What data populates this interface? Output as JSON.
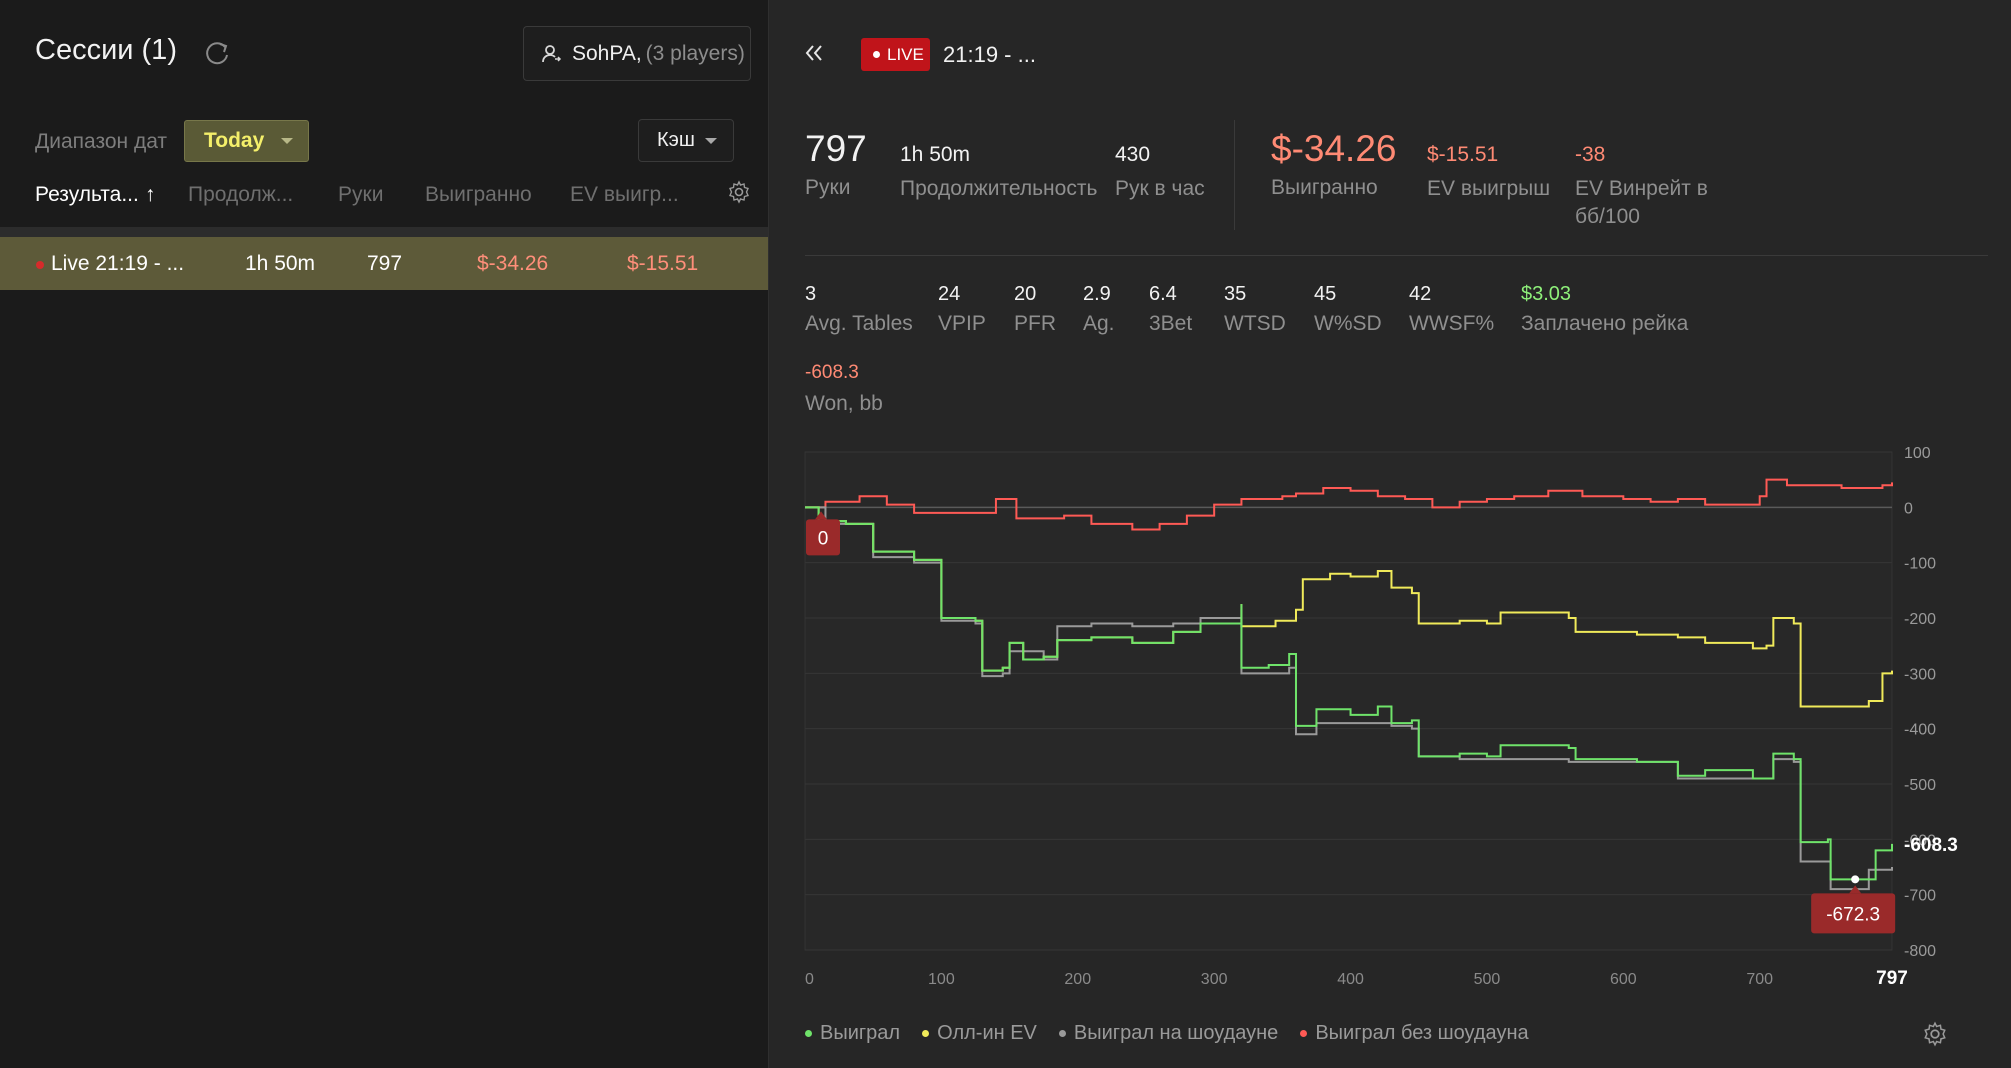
{
  "left": {
    "title": "Сессии (1)",
    "player": {
      "name": "SohPA,",
      "extra": "(3 players)"
    },
    "date_range_label": "Диапазон дат",
    "date_range_value": "Today",
    "game_type": "Кэш",
    "columns": [
      "Результа...",
      "Продолж...",
      "Руки",
      "Выигранно",
      "EV выигр..."
    ],
    "sort_arrow": "↑",
    "session": {
      "name": "Live 21:19 - ...",
      "duration": "1h 50m",
      "hands": "797",
      "won": "$-34.26",
      "ev": "$-15.51"
    }
  },
  "right": {
    "live": "LIVE",
    "title": "21:19 - ...",
    "stats": {
      "hands": {
        "value": "797",
        "label": "Руки"
      },
      "duration": {
        "value": "1h 50m",
        "label": "Продолжительность"
      },
      "hands_per_hour": {
        "value": "430",
        "label": "Рук в час"
      },
      "won": {
        "value": "$-34.26",
        "label": "Выигранно"
      },
      "ev_won": {
        "value": "$-15.51",
        "label": "EV выигрыш"
      },
      "ev_winrate": {
        "value": "-38",
        "label": "EV Винрейт в",
        "label2": "бб/100"
      }
    },
    "stats2": [
      {
        "value": "3",
        "label": "Avg. Tables"
      },
      {
        "value": "24",
        "label": "VPIP"
      },
      {
        "value": "20",
        "label": "PFR"
      },
      {
        "value": "2.9",
        "label": "Ag."
      },
      {
        "value": "6.4",
        "label": "3Bet"
      },
      {
        "value": "35",
        "label": "WTSD"
      },
      {
        "value": "45",
        "label": "W%SD"
      },
      {
        "value": "42",
        "label": "WWSF%"
      },
      {
        "value": "$3.03",
        "label": "Заплачено рейка"
      }
    ],
    "won_bb": {
      "value": "-608.3",
      "label": "Won, bb"
    },
    "legend": [
      {
        "label": "Выиграл",
        "color": "#6fe36a"
      },
      {
        "label": "Олл-ин EV",
        "color": "#f0ea5a"
      },
      {
        "label": "Выиграл на шоудауне",
        "color": "#9a9a9a"
      },
      {
        "label": "Выиграл без шоудауна",
        "color": "#ff5a55"
      }
    ]
  },
  "chart_data": {
    "type": "line",
    "x_range": [
      0,
      797
    ],
    "y_range": [
      -800,
      100
    ],
    "x_ticks": [
      0,
      100,
      200,
      300,
      400,
      500,
      600,
      700
    ],
    "x_end_label": "797",
    "y_ticks": [
      100,
      0,
      -100,
      -200,
      -300,
      -400,
      -500,
      -600,
      -700,
      -800
    ],
    "start_marker": "0",
    "min_marker": {
      "x": 770,
      "y": -672.3,
      "label": "-672.3"
    },
    "end_label": "-608.3",
    "series": [
      {
        "name": "Выиграл",
        "color": "#6fe36a",
        "points": [
          [
            0,
            0
          ],
          [
            10,
            -25
          ],
          [
            30,
            -30
          ],
          [
            50,
            -80
          ],
          [
            80,
            -95
          ],
          [
            100,
            -200
          ],
          [
            125,
            -205
          ],
          [
            130,
            -295
          ],
          [
            145,
            -290
          ],
          [
            150,
            -245
          ],
          [
            160,
            -275
          ],
          [
            175,
            -270
          ],
          [
            185,
            -240
          ],
          [
            210,
            -235
          ],
          [
            240,
            -245
          ],
          [
            270,
            -225
          ],
          [
            290,
            -210
          ],
          [
            320,
            -175
          ],
          [
            320,
            -290
          ],
          [
            340,
            -285
          ],
          [
            355,
            -265
          ],
          [
            360,
            -395
          ],
          [
            375,
            -365
          ],
          [
            400,
            -375
          ],
          [
            420,
            -360
          ],
          [
            430,
            -390
          ],
          [
            445,
            -385
          ],
          [
            450,
            -450
          ],
          [
            480,
            -445
          ],
          [
            500,
            -450
          ],
          [
            510,
            -430
          ],
          [
            560,
            -435
          ],
          [
            565,
            -455
          ],
          [
            610,
            -460
          ],
          [
            630,
            -460
          ],
          [
            640,
            -485
          ],
          [
            660,
            -475
          ],
          [
            695,
            -490
          ],
          [
            705,
            -490
          ],
          [
            710,
            -445
          ],
          [
            725,
            -455
          ],
          [
            730,
            -605
          ],
          [
            750,
            -600
          ],
          [
            752,
            -672.3
          ],
          [
            770,
            -672.3
          ],
          [
            785,
            -620
          ],
          [
            797,
            -608.3
          ]
        ]
      },
      {
        "name": "Олл-ин EV",
        "color": "#f0ea5a",
        "points": [
          [
            0,
            0
          ],
          [
            10,
            -25
          ],
          [
            30,
            -30
          ],
          [
            50,
            -80
          ],
          [
            80,
            -95
          ],
          [
            100,
            -200
          ],
          [
            125,
            -205
          ],
          [
            130,
            -295
          ],
          [
            145,
            -290
          ],
          [
            150,
            -245
          ],
          [
            160,
            -275
          ],
          [
            175,
            -270
          ],
          [
            185,
            -240
          ],
          [
            210,
            -235
          ],
          [
            240,
            -245
          ],
          [
            270,
            -225
          ],
          [
            290,
            -210
          ],
          [
            320,
            -175
          ],
          [
            320,
            -215
          ],
          [
            345,
            -205
          ],
          [
            360,
            -200
          ],
          [
            360,
            -185
          ],
          [
            365,
            -130
          ],
          [
            385,
            -120
          ],
          [
            400,
            -125
          ],
          [
            420,
            -115
          ],
          [
            430,
            -145
          ],
          [
            445,
            -155
          ],
          [
            450,
            -210
          ],
          [
            480,
            -205
          ],
          [
            500,
            -210
          ],
          [
            510,
            -190
          ],
          [
            560,
            -200
          ],
          [
            565,
            -225
          ],
          [
            610,
            -230
          ],
          [
            630,
            -230
          ],
          [
            640,
            -235
          ],
          [
            660,
            -245
          ],
          [
            695,
            -255
          ],
          [
            705,
            -250
          ],
          [
            710,
            -200
          ],
          [
            725,
            -210
          ],
          [
            730,
            -360
          ],
          [
            750,
            -360
          ],
          [
            780,
            -350
          ],
          [
            790,
            -300
          ],
          [
            797,
            -295
          ]
        ]
      },
      {
        "name": "Выиграл на шоудауне",
        "color": "#9a9a9a",
        "points": [
          [
            0,
            0
          ],
          [
            15,
            -30
          ],
          [
            50,
            -90
          ],
          [
            80,
            -100
          ],
          [
            100,
            -205
          ],
          [
            125,
            -210
          ],
          [
            130,
            -305
          ],
          [
            145,
            -300
          ],
          [
            150,
            -260
          ],
          [
            175,
            -275
          ],
          [
            185,
            -215
          ],
          [
            210,
            -210
          ],
          [
            240,
            -215
          ],
          [
            270,
            -210
          ],
          [
            290,
            -200
          ],
          [
            320,
            -185
          ],
          [
            320,
            -300
          ],
          [
            340,
            -300
          ],
          [
            355,
            -290
          ],
          [
            360,
            -410
          ],
          [
            375,
            -390
          ],
          [
            400,
            -390
          ],
          [
            420,
            -390
          ],
          [
            430,
            -395
          ],
          [
            445,
            -400
          ],
          [
            450,
            -450
          ],
          [
            480,
            -455
          ],
          [
            500,
            -455
          ],
          [
            560,
            -460
          ],
          [
            610,
            -460
          ],
          [
            640,
            -490
          ],
          [
            700,
            -490
          ],
          [
            710,
            -455
          ],
          [
            725,
            -460
          ],
          [
            730,
            -640
          ],
          [
            750,
            -640
          ],
          [
            752,
            -690
          ],
          [
            775,
            -690
          ],
          [
            780,
            -655
          ],
          [
            797,
            -650
          ]
        ]
      },
      {
        "name": "Выиграл без шоудауна",
        "color": "#ff5a55",
        "points": [
          [
            0,
            0
          ],
          [
            15,
            10
          ],
          [
            40,
            20
          ],
          [
            60,
            5
          ],
          [
            80,
            -10
          ],
          [
            120,
            -10
          ],
          [
            140,
            15
          ],
          [
            150,
            15
          ],
          [
            155,
            -20
          ],
          [
            190,
            -15
          ],
          [
            210,
            -30
          ],
          [
            230,
            -30
          ],
          [
            240,
            -40
          ],
          [
            260,
            -30
          ],
          [
            280,
            -15
          ],
          [
            300,
            5
          ],
          [
            320,
            15
          ],
          [
            350,
            20
          ],
          [
            360,
            25
          ],
          [
            380,
            35
          ],
          [
            400,
            30
          ],
          [
            420,
            20
          ],
          [
            440,
            15
          ],
          [
            460,
            0
          ],
          [
            480,
            10
          ],
          [
            500,
            15
          ],
          [
            520,
            20
          ],
          [
            545,
            30
          ],
          [
            560,
            30
          ],
          [
            570,
            20
          ],
          [
            600,
            15
          ],
          [
            620,
            10
          ],
          [
            640,
            15
          ],
          [
            660,
            5
          ],
          [
            690,
            5
          ],
          [
            700,
            20
          ],
          [
            705,
            50
          ],
          [
            720,
            40
          ],
          [
            760,
            35
          ],
          [
            790,
            40
          ],
          [
            797,
            45
          ]
        ]
      }
    ]
  }
}
